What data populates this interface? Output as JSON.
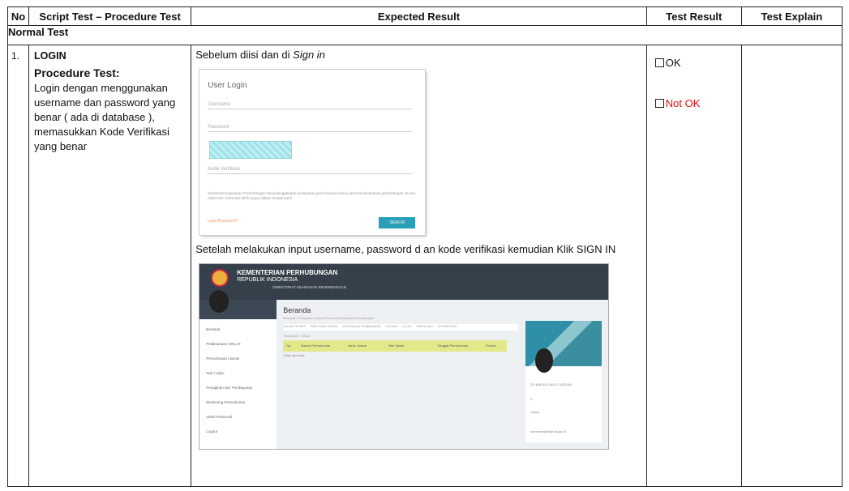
{
  "table": {
    "headers": {
      "no": "No",
      "script": "Script Test – Procedure Test",
      "expected": "Expected Result",
      "result": "Test Result",
      "explain": "Test Explain"
    },
    "section": "Normal Test",
    "row": {
      "no": "1.",
      "title": "LOGIN",
      "procedure_title": "Procedure Test:",
      "procedure_text": "Login dengan menggunakan username dan password yang benar ( ada di database ), memasukkan Kode Verifikasi yang benar",
      "expected_before_prefix": "Sebelum diisi dan di ",
      "expected_before_italic": "Sign in",
      "expected_after": "Setelah melakukan input username, password d an kode verifikasi kemudian Klik SIGN IN",
      "result_ok": "OK",
      "result_not_ok": "Not OK",
      "explain": ""
    }
  },
  "login_mock": {
    "title": "User Login",
    "username_placeholder": "Username",
    "password_placeholder": "Password",
    "code_placeholder": "Kode Verifikasi",
    "note": "Direktorat Keamanan Penerbangan menyelenggarakan pelayanan permohonan lisensi personel keamanan penerbangan secara elektronik. Informasi lebih lanjut silakan kontak kami.",
    "forgot": "Lupa Password?",
    "signin": "SIGN IN"
  },
  "dashboard_mock": {
    "ministry": "KEMENTERIAN PERHUBUNGAN",
    "republic": "REPUBLIK INDONESIA",
    "directorate": "DIREKTORAT KEAMANAN PENERBANGAN",
    "page_title": "Beranda",
    "breadcrumb": "Beranda / Pelayanan Lisensi Personil Keamanan Penerbangan",
    "tabs": [
      "DALAM PROSES",
      "DATA TIDAK SESUAI",
      "DATA DALAM PEMBAHASAN",
      "DITOLAK",
      "LULUS",
      "PENGUJIAN",
      "DITERBITKAN"
    ],
    "total": "Total Data : 0 Baris",
    "columns": [
      "No.",
      "Nomor Permohonan",
      "Jenis Lisensi",
      "Nier Nama",
      "Tanggal Permohonan",
      "Proses"
    ],
    "empty": "Tidak ada data",
    "menu": [
      "Beranda",
      "Pelaksanaan DIKLAT",
      "Permohonan Lisensi",
      "Test / Ujian",
      "Penagihan dan Pembayaran",
      "Monitoring Permohonan",
      "Ubah Password",
      "Logout"
    ],
    "profile_name": "DP BADAN DIKLAT MEDAN",
    "profile_extra": [
      "0",
      "Aktual",
      "-"
    ],
    "profile_email": "someone@dephub.go.id"
  }
}
